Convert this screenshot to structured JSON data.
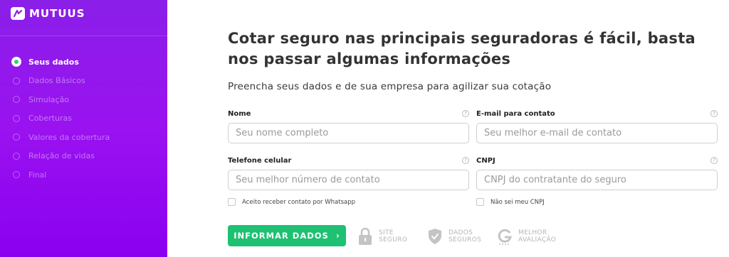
{
  "brand": {
    "name": "mutuus"
  },
  "steps": [
    {
      "label": "Seus dados",
      "active": true
    },
    {
      "label": "Dados Básicos"
    },
    {
      "label": "Simulação"
    },
    {
      "label": "Coberturas"
    },
    {
      "label": "Valores da cobertura"
    },
    {
      "label": "Relação de vidas"
    },
    {
      "label": "Final"
    }
  ],
  "main": {
    "title": "Cotar seguro nas principais seguradoras é fácil, basta nos passar algumas informações",
    "subtitle": "Preencha seus dados e de sua empresa para agilizar sua cotação"
  },
  "form": {
    "nome": {
      "label": "Nome",
      "placeholder": "Seu nome completo",
      "value": ""
    },
    "email": {
      "label": "E-mail para contato",
      "placeholder": "Seu melhor e-mail de contato",
      "value": ""
    },
    "telefone": {
      "label": "Telefone celular",
      "placeholder": "Seu melhor número de contato",
      "value": ""
    },
    "cnpj": {
      "label": "CNPJ",
      "placeholder": "CNPJ do contratante do seguro",
      "value": ""
    },
    "help_glyph": "?",
    "whatsapp_check": {
      "label": "Aceito receber contato por Whatsapp",
      "checked": false
    },
    "no_cnpj_check": {
      "label": "Não sei meu CNPJ",
      "checked": false
    },
    "submit": {
      "label": "INFORMAR DADOS",
      "arrow": "›"
    }
  },
  "badges": {
    "site": {
      "line1": "SITE",
      "line2": "SEGURO",
      "icon": "lock-icon"
    },
    "dados": {
      "line1": "DADOS",
      "line2": "SEGUROS",
      "icon": "shield-check-icon"
    },
    "aval": {
      "line1": "MELHOR",
      "line2": "AVALIAÇÃO",
      "icon": "google-g-icon"
    }
  },
  "colors": {
    "sidebar_purple": "#8a1fe8",
    "accent_green": "#1ec072",
    "active_dot_green": "#2ed27c"
  }
}
